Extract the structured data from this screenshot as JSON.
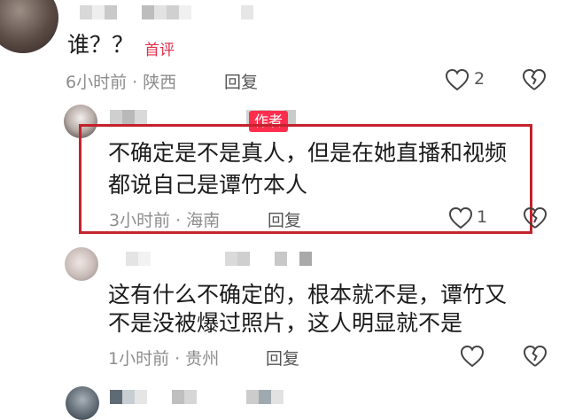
{
  "comments": [
    {
      "text": "谁？？",
      "badge": "首评",
      "time_location": "6小时前 · 陕西",
      "reply_label": "回复",
      "like_count": "2"
    },
    {
      "badge": "作者",
      "text_line1": "不确定是不是真人，但是在她直播和视频",
      "text_line2": "都说自己是谭竹本人",
      "time_location": "3小时前 · 海南",
      "reply_label": "回复",
      "like_count": "1"
    },
    {
      "text_line1": "这有什么不确定的，根本就不是，谭竹又",
      "text_line2": "不是没被爆过照片，这人明显就不是",
      "time_location": "1小时前 · 贵州",
      "reply_label": "回复"
    }
  ],
  "colors": {
    "highlight": "#c3222c",
    "badge_red": "#ff2e4d",
    "first_badge_text": "#e0304a",
    "meta_gray": "#8d8d8d"
  },
  "icons": [
    "heart-outline-icon",
    "broken-heart-icon"
  ]
}
